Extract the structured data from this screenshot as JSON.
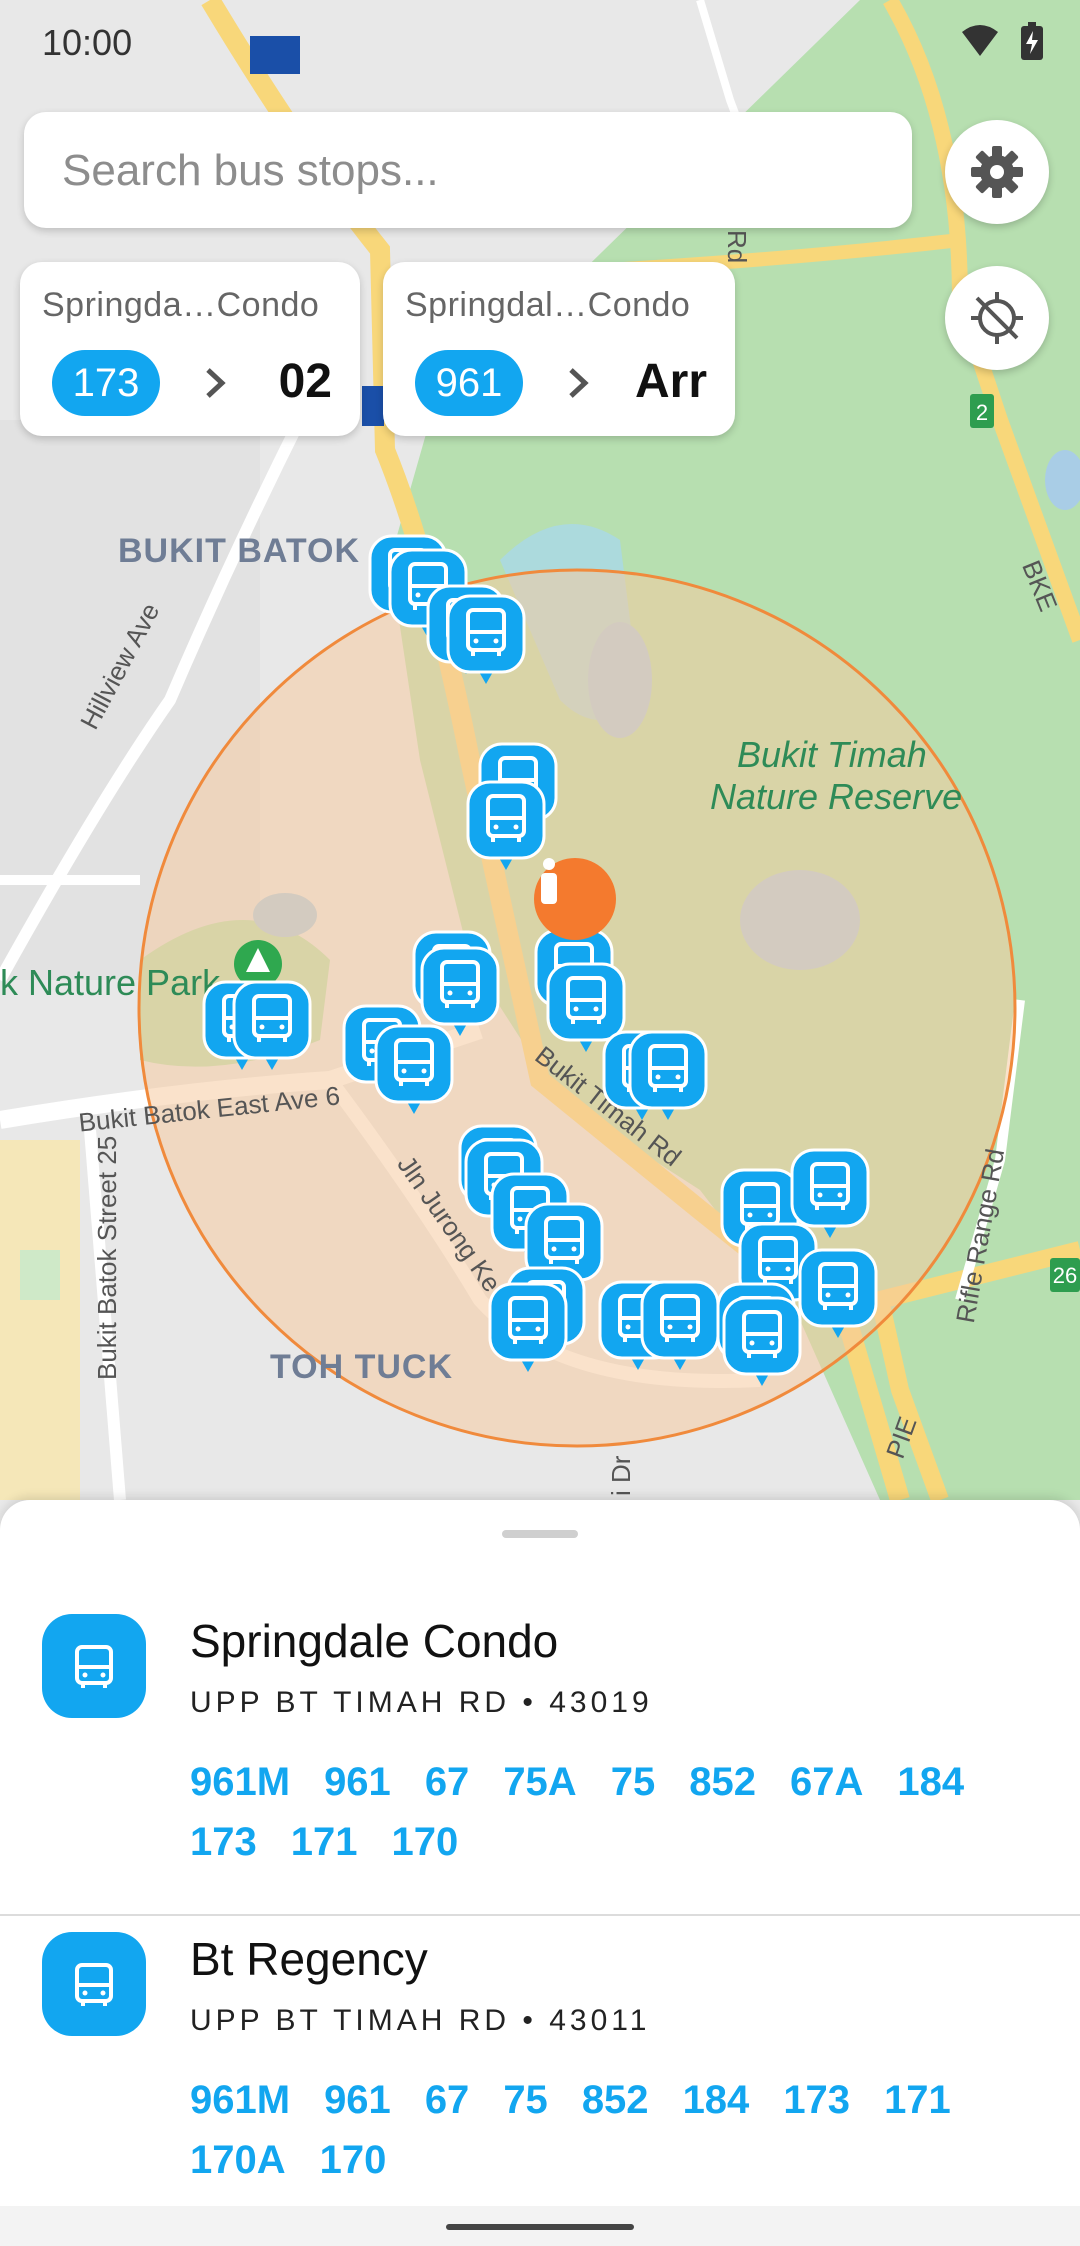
{
  "status_bar": {
    "time": "10:00",
    "icons": [
      "wifi-icon",
      "battery-charging-icon"
    ]
  },
  "search": {
    "placeholder": "Search bus stops..."
  },
  "fabs": {
    "settings_icon": "gear-icon",
    "location_icon": "location-off-icon"
  },
  "pinned": [
    {
      "name": "Springda…Condo",
      "service": "173",
      "eta": "02"
    },
    {
      "name": "Springdal…Condo",
      "service": "961",
      "eta": "Arr"
    }
  ],
  "map": {
    "area_labels": [
      "BUKIT BATOK",
      "TOH TUCK"
    ],
    "park_labels": [
      "Bukit Timah",
      "Nature Reserve",
      "k Nature Park"
    ],
    "road_labels": [
      "Hillview Ave",
      "Bukit Batok East Ave 6",
      "Bukit Batok Street 25",
      "Jln Jurong Ke",
      "Bukit Timah Rd",
      "Rifle Range Rd",
      "PIE",
      "BKE",
      "Rd",
      "i Dr"
    ],
    "shields": [
      "2",
      "26"
    ],
    "colors": {
      "radius_fill": "#f5caa0",
      "radius_stroke": "#f08a3c",
      "stop_marker": "#12a6f0",
      "user_marker": "#f47a2e",
      "park": "#b7dfb0",
      "road": "#f8d77a"
    }
  },
  "stops": [
    {
      "name": "Springdale Condo",
      "road": "UPP BT TIMAH RD",
      "code": "43019",
      "services": [
        "961M",
        "961",
        "67",
        "75A",
        "75",
        "852",
        "67A",
        "184",
        "173",
        "171",
        "170"
      ]
    },
    {
      "name": "Bt Regency",
      "road": "UPP BT TIMAH RD",
      "code": "43011",
      "services": [
        "961M",
        "961",
        "67",
        "75",
        "852",
        "184",
        "173",
        "171",
        "170A",
        "170"
      ]
    }
  ]
}
